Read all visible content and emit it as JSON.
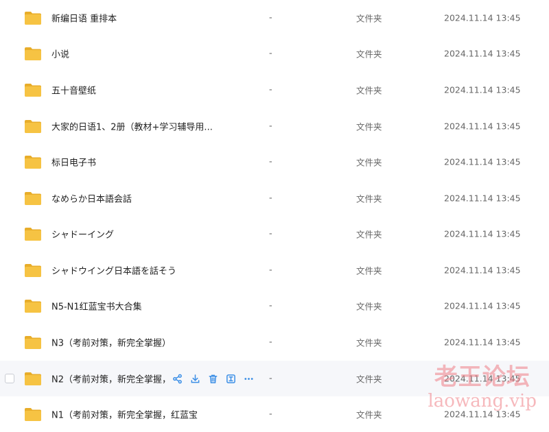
{
  "colors": {
    "folder": "#f6c343",
    "folder_dark": "#e8ad2a",
    "action_icon": "#3a8ee6",
    "watermark": "#ef7f86",
    "hover_row": "#f6f7fa"
  },
  "rows": [
    {
      "name": "新编日语 重排本",
      "size": "-",
      "type": "文件夹",
      "date": "2024.11.14 13:45"
    },
    {
      "name": "小说",
      "size": "-",
      "type": "文件夹",
      "date": "2024.11.14 13:45"
    },
    {
      "name": "五十音壁纸",
      "size": "-",
      "type": "文件夹",
      "date": "2024.11.14 13:45"
    },
    {
      "name": "大家的日语1、2册（教材+学习辅导用...",
      "size": "-",
      "type": "文件夹",
      "date": "2024.11.14 13:45"
    },
    {
      "name": "标日电子书",
      "size": "-",
      "type": "文件夹",
      "date": "2024.11.14 13:45"
    },
    {
      "name": "なめらか日本語会話",
      "size": "-",
      "type": "文件夹",
      "date": "2024.11.14 13:45"
    },
    {
      "name": "シャドーイング",
      "size": "-",
      "type": "文件夹",
      "date": "2024.11.14 13:45"
    },
    {
      "name": "シャドウイング日本語を話そう",
      "size": "-",
      "type": "文件夹",
      "date": "2024.11.14 13:45"
    },
    {
      "name": "N5-N1红蓝宝书大合集",
      "size": "-",
      "type": "文件夹",
      "date": "2024.11.14 13:45"
    },
    {
      "name": "N3（考前对策，新完全掌握）",
      "size": "-",
      "type": "文件夹",
      "date": "2024.11.14 13:45"
    },
    {
      "name": "N2（考前对策，新完全掌握，",
      "size": "-",
      "type": "文件夹",
      "date": "2024.11.14 13:45"
    },
    {
      "name": "N1（考前对策，新完全掌握，红蓝宝",
      "size": "-",
      "type": "文件夹",
      "date": "2024.11.14 13:45"
    }
  ],
  "hover_actions": [
    {
      "icon": "share-icon"
    },
    {
      "icon": "download-icon"
    },
    {
      "icon": "delete-icon"
    },
    {
      "icon": "rename-icon"
    },
    {
      "icon": "more-icon"
    }
  ],
  "watermark": {
    "cn": "老王论坛",
    "en": "laowang.vip"
  }
}
